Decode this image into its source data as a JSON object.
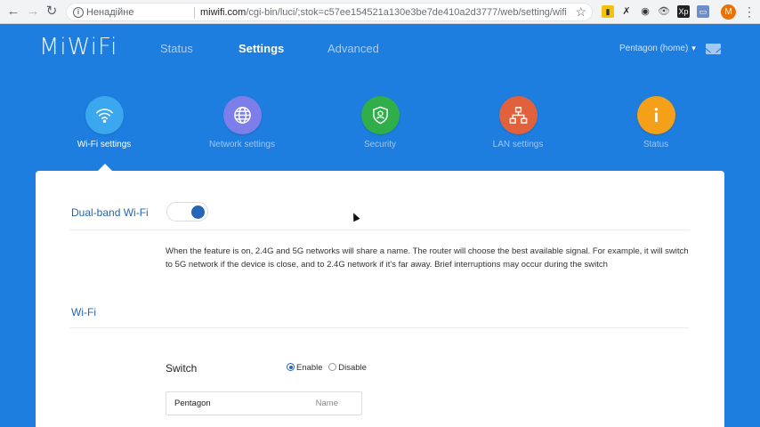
{
  "browser": {
    "security_label": "Ненадійне",
    "url_host": "miwifi.com",
    "url_path": "/cgi-bin/luci/;stok=c57ee154521a130e3be7de410a2d3777/web/setting/wifi",
    "profile_initial": "M",
    "extensions": [
      "keep-icon",
      "vpn-icon",
      "eye-icon",
      "eye-alt-icon",
      "xp-icon",
      "cast-icon"
    ],
    "extension_xp_label": "Xp"
  },
  "header": {
    "logo": "MiWiFi",
    "nav": {
      "status": "Status",
      "settings": "Settings",
      "advanced": "Advanced"
    },
    "router_name": "Pentagon (home)"
  },
  "categories": {
    "wifi": {
      "label": "Wi-Fi settings",
      "color": "#3aa7ee"
    },
    "network": {
      "label": "Network settings",
      "color": "#7d7ee9"
    },
    "security": {
      "label": "Security",
      "color": "#2fae4a"
    },
    "lan": {
      "label": "LAN settings",
      "color": "#e0613b"
    },
    "status": {
      "label": "Status",
      "color": "#f4a019"
    }
  },
  "dual_band": {
    "title": "Dual-band Wi-Fi",
    "enabled": true,
    "description": "When the feature is on, 2.4G and 5G networks will share a name. The router will choose the best available signal. For example, it will switch to 5G network if the device is close, and to 2.4G network if it's far away. Brief interruptions may occur during the switch"
  },
  "wifi": {
    "title": "Wi-Fi",
    "switch_label": "Switch",
    "enable_label": "Enable",
    "disable_label": "Disable",
    "selected": "Enable",
    "name_value": "Pentagon",
    "name_placeholder": "Name"
  }
}
